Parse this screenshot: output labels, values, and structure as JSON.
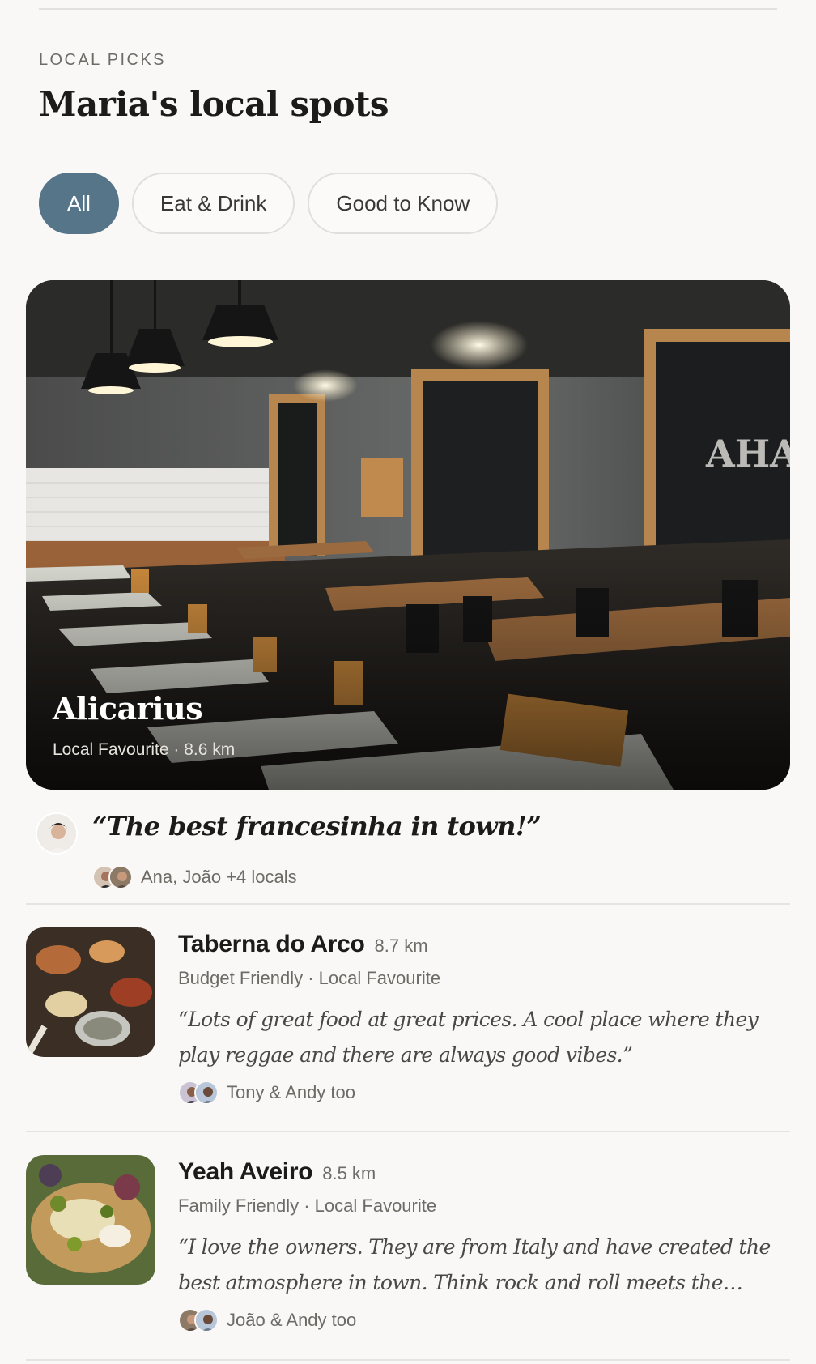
{
  "section": {
    "eyebrow": "LOCAL PICKS",
    "title": "Maria's local spots"
  },
  "filters": [
    {
      "label": "All",
      "active": true
    },
    {
      "label": "Eat & Drink",
      "active": false
    },
    {
      "label": "Good to Know",
      "active": false
    }
  ],
  "featured": {
    "name": "Alicarius",
    "meta": "Local Favourite · 8.6 km",
    "quote": "“The best francesinha in town!”",
    "locals": "Ana, João +4 locals"
  },
  "places": [
    {
      "name": "Taberna do Arco",
      "distance": "8.7 km",
      "tags": "Budget Friendly · Local Favourite",
      "quote": "“Lots of great food at great prices. A cool place where they play reggae and there are always good vibes.”",
      "locals": "Tony & Andy too"
    },
    {
      "name": "Yeah Aveiro",
      "distance": "8.5 km",
      "tags": "Family Friendly · Local Favourite",
      "quote": "“I love the owners. They are from Italy and have created the best atmosphere in town. Think rock and roll meets the heart of true Italian cooking.”",
      "locals": "João & Andy too"
    }
  ],
  "colors": {
    "accent": "#567589",
    "background": "#f9f8f6",
    "text": "#1c1b1a",
    "muted": "#6e6b67"
  }
}
